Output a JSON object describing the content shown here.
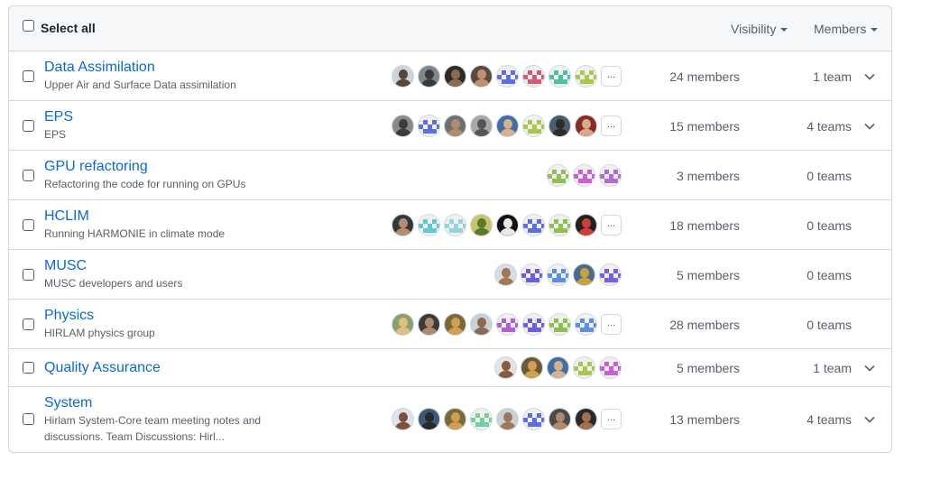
{
  "header": {
    "select_all": "Select all",
    "visibility_filter": "Visibility",
    "members_filter": "Members"
  },
  "colors": {
    "link": "#0969da",
    "muted": "#57606a",
    "border": "#d0d7de",
    "header_bg": "#f6f8fa"
  },
  "teams": [
    {
      "name": "Data Assimilation",
      "description": "Upper Air and Surface Data assimilation",
      "members": "24 members",
      "teams": "1 team",
      "expandable": true,
      "has_more": true,
      "avatars": [
        {
          "kind": "photo",
          "bg": "#c9d4de",
          "fg": "#5a4636"
        },
        {
          "kind": "photo",
          "bg": "#7d8790",
          "fg": "#3a3a3a"
        },
        {
          "kind": "photo",
          "bg": "#2d2a2a",
          "fg": "#8b6a55"
        },
        {
          "kind": "photo",
          "bg": "#5e4a3c",
          "fg": "#c09070"
        },
        {
          "kind": "ident",
          "color": "#5b6fe0"
        },
        {
          "kind": "ident",
          "color": "#d9587a"
        },
        {
          "kind": "ident",
          "color": "#4cc0a3"
        },
        {
          "kind": "ident",
          "color": "#a6c94d"
        }
      ]
    },
    {
      "name": "EPS",
      "description": "EPS",
      "members": "15 members",
      "teams": "4 teams",
      "expandable": true,
      "has_more": true,
      "avatars": [
        {
          "kind": "photo",
          "bg": "#8a8a8a",
          "fg": "#3c3c3c"
        },
        {
          "kind": "ident",
          "color": "#5b6fe0"
        },
        {
          "kind": "photo",
          "bg": "#6f6f6f",
          "fg": "#b18c6e"
        },
        {
          "kind": "photo",
          "bg": "#a8a8a8",
          "fg": "#555555"
        },
        {
          "kind": "photo",
          "bg": "#3f6fa8",
          "fg": "#d6b08f"
        },
        {
          "kind": "ident",
          "color": "#a6c94d"
        },
        {
          "kind": "photo",
          "bg": "#4b5e70",
          "fg": "#2c2c2c"
        },
        {
          "kind": "photo",
          "bg": "#8a2a22",
          "fg": "#d9a98a"
        }
      ]
    },
    {
      "name": "GPU refactoring",
      "description": "Refactoring the code for running on GPUs",
      "members": "3 members",
      "teams": "0 teams",
      "expandable": false,
      "has_more": false,
      "avatars": [
        {
          "kind": "ident",
          "color": "#8dc04d"
        },
        {
          "kind": "ident",
          "color": "#c95fd6"
        },
        {
          "kind": "ident",
          "color": "#b36ad9"
        }
      ]
    },
    {
      "name": "HCLIM",
      "description": "Running HARMONIE in climate mode",
      "members": "18 members",
      "teams": "0 teams",
      "expandable": false,
      "has_more": true,
      "avatars": [
        {
          "kind": "photo",
          "bg": "#2f3a3f",
          "fg": "#b58d70"
        },
        {
          "kind": "ident",
          "color": "#5fc8d6"
        },
        {
          "kind": "ident",
          "color": "#8fd4e0"
        },
        {
          "kind": "photo",
          "bg": "#c9c46a",
          "fg": "#5a7a2a"
        },
        {
          "kind": "photo",
          "bg": "#111111",
          "fg": "#e8e8e8"
        },
        {
          "kind": "ident",
          "color": "#5b6fe0"
        },
        {
          "kind": "ident",
          "color": "#8dc04d"
        },
        {
          "kind": "photo",
          "bg": "#222222",
          "fg": "#c9403a"
        }
      ]
    },
    {
      "name": "MUSC",
      "description": "MUSC developers and users",
      "members": "5 members",
      "teams": "0 teams",
      "expandable": false,
      "has_more": false,
      "avatars": [
        {
          "kind": "photo",
          "bg": "#d8dde2",
          "fg": "#a07858"
        },
        {
          "kind": "ident",
          "color": "#6a5fe0"
        },
        {
          "kind": "ident",
          "color": "#5b8fe0"
        },
        {
          "kind": "photo",
          "bg": "#4a6a8a",
          "fg": "#c8a040"
        },
        {
          "kind": "ident",
          "color": "#7a5fe0"
        }
      ]
    },
    {
      "name": "Physics",
      "description": "HIRLAM physics group",
      "members": "28 members",
      "teams": "0 teams",
      "expandable": false,
      "has_more": true,
      "avatars": [
        {
          "kind": "photo",
          "bg": "#8aa070",
          "fg": "#e0c080"
        },
        {
          "kind": "photo",
          "bg": "#3a3a3a",
          "fg": "#b08a6a"
        },
        {
          "kind": "photo",
          "bg": "#7a6a3a",
          "fg": "#d0a050"
        },
        {
          "kind": "photo",
          "bg": "#c8d0d8",
          "fg": "#8a6a50"
        },
        {
          "kind": "ident",
          "color": "#b05fd6"
        },
        {
          "kind": "ident",
          "color": "#6a5fe0"
        },
        {
          "kind": "ident",
          "color": "#8dc04d"
        },
        {
          "kind": "ident",
          "color": "#5b8fe0"
        }
      ]
    },
    {
      "name": "Quality Assurance",
      "description": "",
      "members": "5 members",
      "teams": "1 team",
      "expandable": true,
      "has_more": false,
      "avatars": [
        {
          "kind": "photo",
          "bg": "#e0e4e8",
          "fg": "#8a5a40"
        },
        {
          "kind": "photo",
          "bg": "#6a5a3a",
          "fg": "#d0a050"
        },
        {
          "kind": "photo",
          "bg": "#3f6fa8",
          "fg": "#d6b08f"
        },
        {
          "kind": "ident",
          "color": "#a6c94d"
        },
        {
          "kind": "ident",
          "color": "#c95fd6"
        }
      ]
    },
    {
      "name": "System",
      "description": "Hirlam System-Core team meeting notes and discussions. Team Discussions: Hirl...",
      "members": "13 members",
      "teams": "4 teams",
      "expandable": true,
      "has_more": true,
      "avatars": [
        {
          "kind": "photo",
          "bg": "#e0e4e8",
          "fg": "#7a5240"
        },
        {
          "kind": "photo",
          "bg": "#3a5a7a",
          "fg": "#2a2a2a"
        },
        {
          "kind": "photo",
          "bg": "#7a6a3a",
          "fg": "#d0a050"
        },
        {
          "kind": "ident",
          "color": "#6fd0a0"
        },
        {
          "kind": "photo",
          "bg": "#c8d0d8",
          "fg": "#a07858"
        },
        {
          "kind": "ident",
          "color": "#5b6fe0"
        },
        {
          "kind": "photo",
          "bg": "#4a4a4a",
          "fg": "#b08a6a"
        },
        {
          "kind": "photo",
          "bg": "#2a2a2a",
          "fg": "#a07050"
        }
      ]
    }
  ],
  "more_label": "..."
}
